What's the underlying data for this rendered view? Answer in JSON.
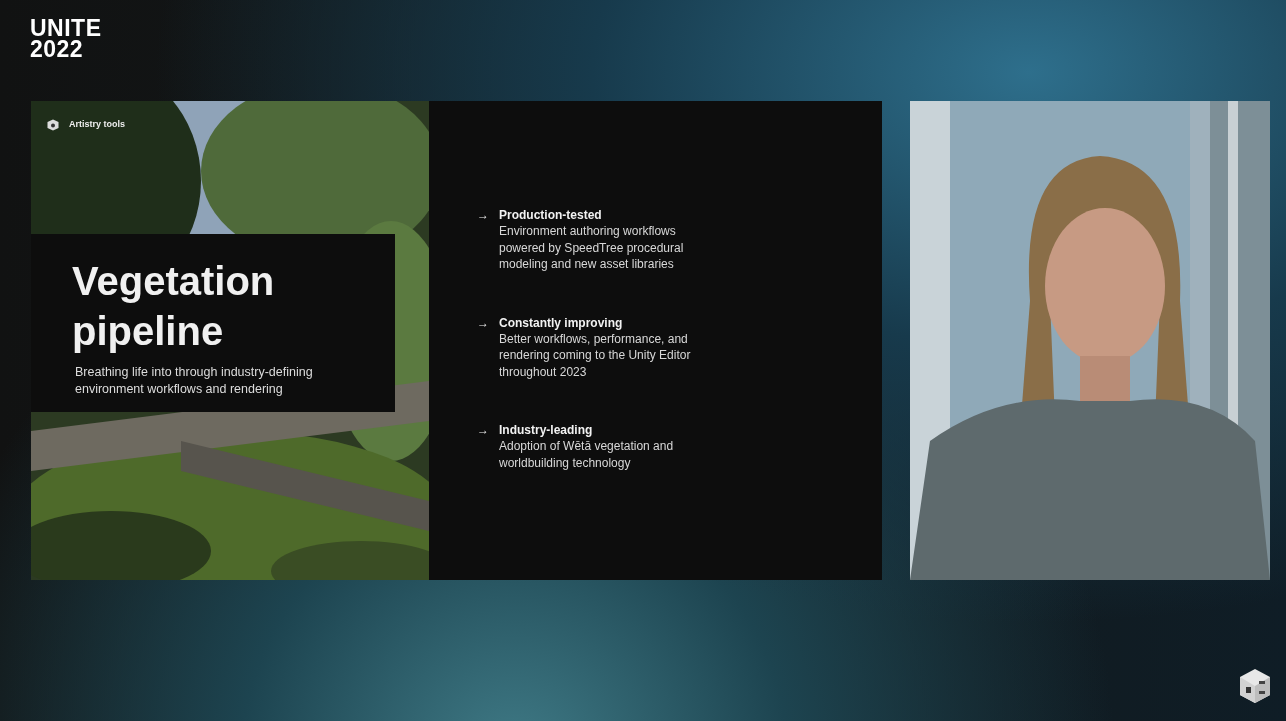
{
  "event_logo": {
    "line_1": "UNITE",
    "line_2": "2022"
  },
  "slide": {
    "category": "Artistry tools",
    "title_line_1": "Vegetation",
    "title_line_2": "pipeline",
    "subtitle": "Breathing life into through industry-defining environment workflows and rendering",
    "points": [
      {
        "arrow": "→",
        "heading": "Production-tested",
        "body": "Environment authoring workflows powered by SpeedTree procedural modeling and new asset libraries"
      },
      {
        "arrow": "→",
        "heading": "Constantly improving",
        "body": "Better workflows, performance, and rendering coming to the Unity Editor throughout 2023"
      },
      {
        "arrow": "→",
        "heading": "Industry-leading",
        "body": "Adoption of Wētā vegetation and worldbuilding technology"
      }
    ]
  }
}
